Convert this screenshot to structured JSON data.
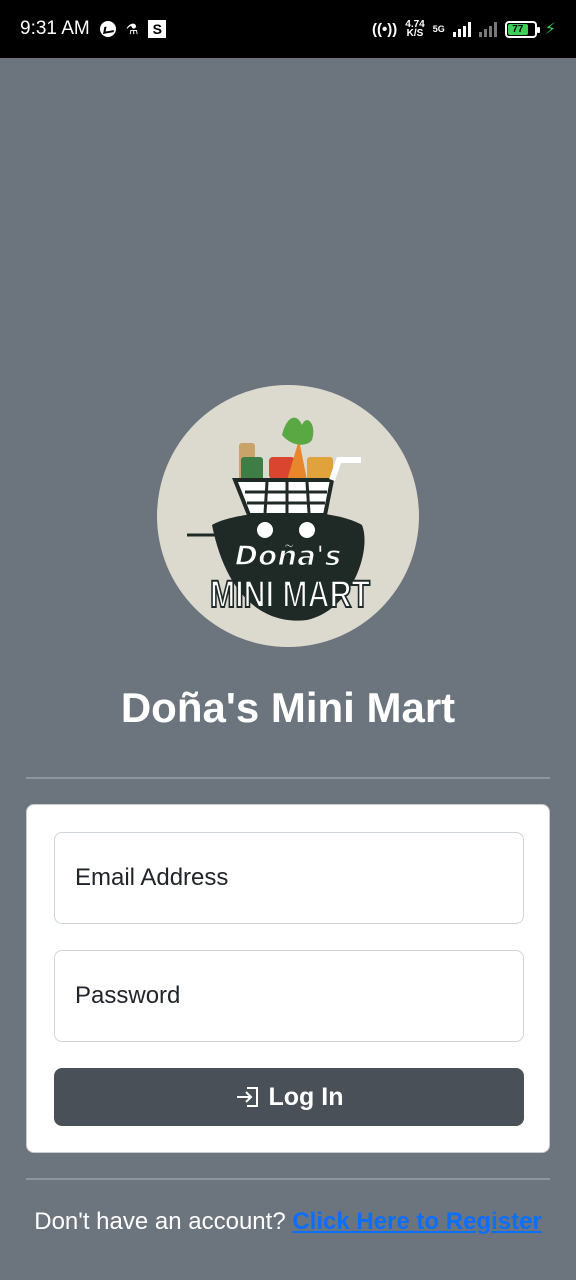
{
  "status_bar": {
    "time": "9:31 AM",
    "speed_value": "4.74",
    "speed_unit": "K/S",
    "network": "5G",
    "battery": "77"
  },
  "logo": {
    "line1": "Doña's",
    "line2": "MINI MART"
  },
  "app_title": "Doña's Mini Mart",
  "login_form": {
    "email_placeholder": "Email Address",
    "password_placeholder": "Password",
    "login_label": "Log In"
  },
  "register": {
    "prompt": "Don't have an account?",
    "link_label": "Click Here to Register"
  },
  "colors": {
    "background": "#6c757d",
    "button": "#495057",
    "link": "#0d6efd"
  }
}
